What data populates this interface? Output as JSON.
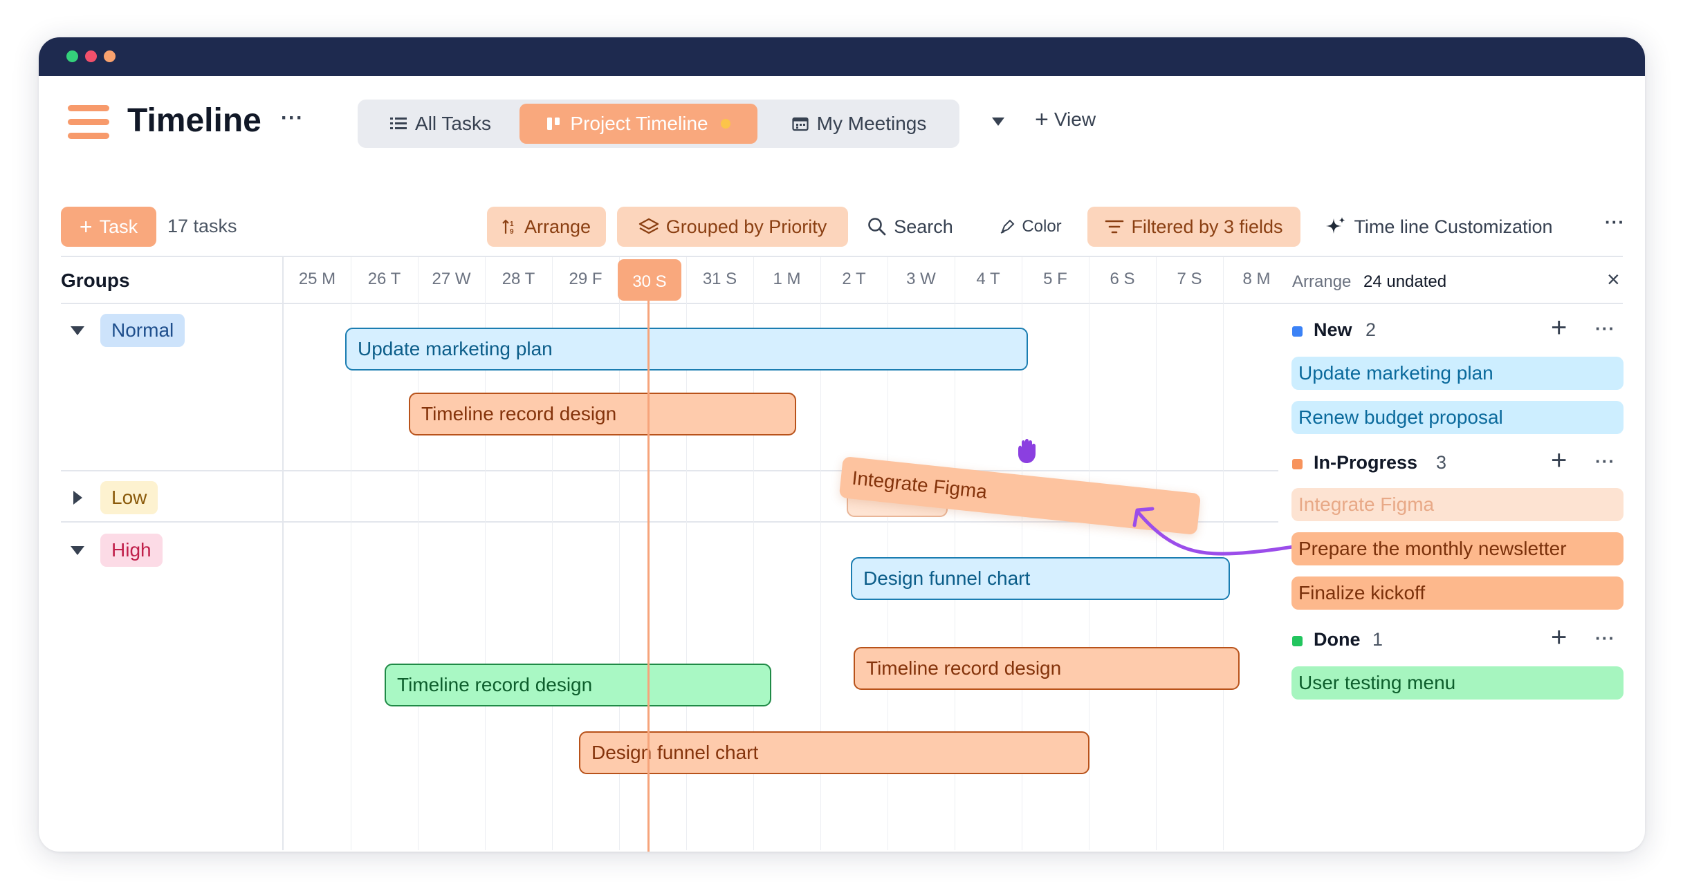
{
  "header": {
    "title": "Timeline",
    "more": "···",
    "tabs": [
      {
        "label": "All Tasks",
        "icon": "list-icon"
      },
      {
        "label": "Project Timeline",
        "icon": "timeline-icon",
        "active": true
      },
      {
        "label": "My Meetings",
        "icon": "calendar-icon"
      }
    ],
    "add_view": "View"
  },
  "toolbar": {
    "task_button": "Task",
    "task_count": "17 tasks",
    "arrange": "Arrange",
    "grouped": "Grouped by Priority",
    "search": "Search",
    "color": "Color",
    "filter": "Filtered by 3 fields",
    "customization": "Time line Customization",
    "more": "···"
  },
  "timeline": {
    "groups_header": "Groups",
    "days": [
      "25 M",
      "26 T",
      "27 W",
      "28 T",
      "29 F",
      "30 S",
      "31 S",
      "1 M",
      "2 T",
      "3 W",
      "4 T",
      "5 F",
      "6 S",
      "7 S",
      "8 M"
    ],
    "today": "30 S",
    "groups": [
      {
        "label": "Normal",
        "expanded": true,
        "bg": "#cde3fb",
        "fg": "#1e4e8c"
      },
      {
        "label": "Low",
        "expanded": false,
        "bg": "#fdf2d0",
        "fg": "#8a5a0b"
      },
      {
        "label": "High",
        "expanded": true,
        "bg": "#fcdbe6",
        "fg": "#c01f4a"
      }
    ],
    "bars": [
      {
        "label": "Update marketing plan",
        "color": "blue"
      },
      {
        "label": "Timeline record design",
        "color": "orange"
      },
      {
        "label": "Integrate Figma",
        "color": "orange",
        "dragging": true
      },
      {
        "label": "Design funnel chart",
        "color": "blue"
      },
      {
        "label": "Timeline record design",
        "color": "orange"
      },
      {
        "label": "Timeline record design",
        "color": "green"
      },
      {
        "label": "Design funnel chart",
        "color": "orange"
      }
    ]
  },
  "panel": {
    "arrange_label": "Arrange",
    "undated": "24 undated",
    "close": "×",
    "sections": [
      {
        "title": "New",
        "count": "2",
        "color": "#3b82f6",
        "cards": [
          {
            "label": "Update marketing plan",
            "style": "blue"
          },
          {
            "label": "Renew budget proposal",
            "style": "blue"
          }
        ]
      },
      {
        "title": "In-Progress",
        "count": "3",
        "color": "#f7935c",
        "cards": [
          {
            "label": "Integrate Figma",
            "style": "ghost"
          },
          {
            "label": "Prepare the monthly newsletter",
            "style": "orange"
          },
          {
            "label": "Finalize kickoff",
            "style": "orange"
          }
        ]
      },
      {
        "title": "Done",
        "count": "1",
        "color": "#22c55e",
        "cards": [
          {
            "label": "User testing menu",
            "style": "green"
          }
        ]
      }
    ]
  },
  "colors": {
    "titlebar": "#1e2a4f",
    "accent": "#f9a87d",
    "today_line": "#f6a47b",
    "drag_arrow": "#9b4dea"
  }
}
